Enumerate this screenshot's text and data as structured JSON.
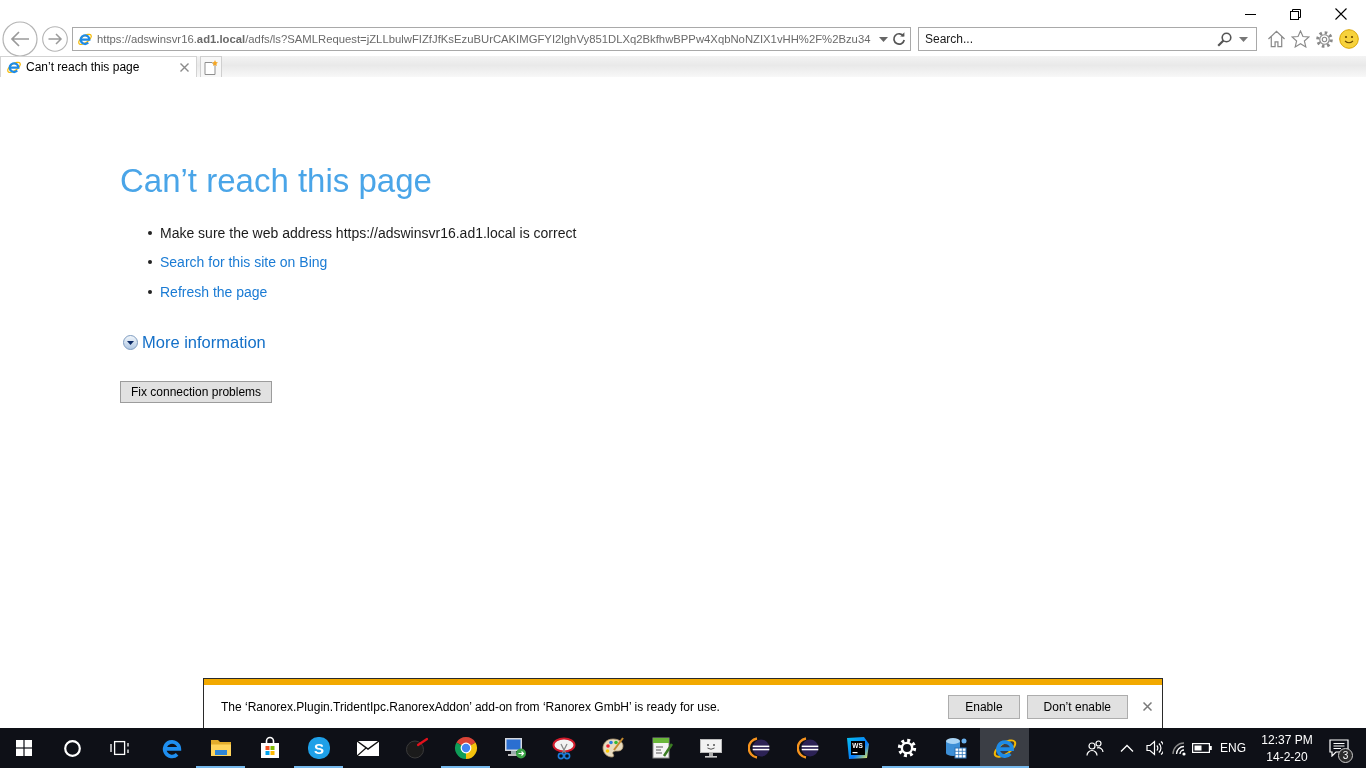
{
  "address_bar": {
    "url": "https://adswinsvr16.**ad1.local**/adfs/ls?SAMLRequest=jZLLbulwFIZfJfKsEzuBUrCAKIMGFYI2lghVy851DLXq2BkfhwBPPw4XqbNoNZIX1vHH%2F%2Bzu34"
  },
  "search": {
    "placeholder": "Search..."
  },
  "tabs": [
    {
      "title": "Can’t reach this page",
      "selected": true
    }
  ],
  "page": {
    "title": "Can’t reach this page",
    "suggestions": [
      {
        "kind": "text",
        "text": "Make sure the web address https://adswinsvr16.ad1.local is correct"
      },
      {
        "kind": "link",
        "text": "Search for this site on Bing"
      },
      {
        "kind": "link",
        "text": "Refresh the page"
      }
    ],
    "more_info": {
      "label": "More information",
      "expanded": false
    },
    "action_button": "Fix connection problems"
  },
  "notification": {
    "message": "The ‘Ranorex.Plugin.TridentIpc.RanorexAddon’ add-on from ‘Ranorex GmbH’ is ready for use.",
    "buttons": [
      "Enable",
      "Don’t enable"
    ]
  },
  "taskbar": {
    "apps": [
      {
        "running": false,
        "selected": false
      },
      {
        "running": true,
        "selected": false
      },
      {
        "running": false,
        "selected": false
      },
      {
        "running": true,
        "selected": false,
        "logo_text": "S"
      },
      {
        "running": false,
        "selected": false
      },
      {
        "running": false,
        "selected": false
      },
      {
        "running": true,
        "selected": false
      },
      {
        "running": false,
        "selected": false
      },
      {
        "running": false,
        "selected": false
      },
      {
        "running": false,
        "selected": false
      },
      {
        "running": false,
        "selected": false
      },
      {
        "running": false,
        "selected": false
      },
      {
        "running": false,
        "selected": false
      },
      {
        "running": false,
        "selected": false
      },
      {
        "running": false,
        "selected": false,
        "logo_text": "WS"
      },
      {
        "running": true,
        "selected": false
      },
      {
        "running": true,
        "selected": false
      },
      {
        "running": true,
        "selected": true
      }
    ],
    "tray": {
      "language": "ENG",
      "time": "12:37 PM",
      "date": "14-2-20",
      "notifications": "3"
    }
  }
}
